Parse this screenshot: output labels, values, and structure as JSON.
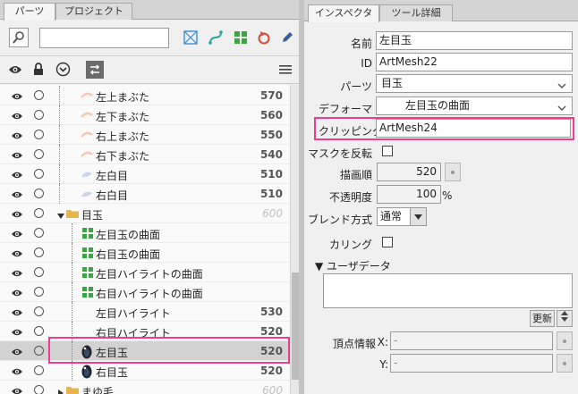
{
  "left_panel": {
    "tabs": [
      {
        "label": "パーツ",
        "active": true
      },
      {
        "label": "プロジェクト",
        "active": false
      }
    ],
    "search": {
      "value": "",
      "placeholder": ""
    },
    "toolbar_icons": [
      "zoom-icon",
      "mesh-edit-icon",
      "curve-icon",
      "deformer-grid-icon",
      "rotation-deformer-icon",
      "pen-icon"
    ],
    "header_icons": [
      "eye-icon",
      "lock-icon",
      "chevron-circle-icon",
      "swap-icon",
      "menu-icon"
    ],
    "rows": [
      {
        "label": "左上まぶた",
        "order": "570",
        "type": "mesh",
        "thumb": "lid",
        "dim": false
      },
      {
        "label": "左下まぶた",
        "order": "560",
        "type": "mesh",
        "thumb": "lid",
        "dim": false
      },
      {
        "label": "右上まぶた",
        "order": "550",
        "type": "mesh",
        "thumb": "lid",
        "dim": false
      },
      {
        "label": "右下まぶた",
        "order": "540",
        "type": "mesh",
        "thumb": "lid",
        "dim": false
      },
      {
        "label": "左白目",
        "order": "510",
        "type": "mesh",
        "thumb": "white",
        "dim": false
      },
      {
        "label": "右白目",
        "order": "510",
        "type": "mesh",
        "thumb": "white",
        "dim": false
      },
      {
        "label": "目玉",
        "order": "600",
        "type": "folder",
        "thumb": "folder",
        "dim": true
      },
      {
        "label": "左目玉の曲面",
        "order": "",
        "type": "deformer",
        "thumb": "deformer",
        "dim": false
      },
      {
        "label": "右目玉の曲面",
        "order": "",
        "type": "deformer",
        "thumb": "deformer",
        "dim": false
      },
      {
        "label": "左目ハイライトの曲面",
        "order": "",
        "type": "deformer",
        "thumb": "deformer",
        "dim": false
      },
      {
        "label": "右目ハイライトの曲面",
        "order": "",
        "type": "deformer",
        "thumb": "deformer",
        "dim": false
      },
      {
        "label": "左目ハイライト",
        "order": "530",
        "type": "mesh",
        "thumb": "none",
        "dim": false
      },
      {
        "label": "右目ハイライト",
        "order": "520",
        "type": "mesh",
        "thumb": "none",
        "dim": false
      },
      {
        "label": "左目玉",
        "order": "520",
        "type": "mesh",
        "thumb": "eyeball",
        "dim": false,
        "selected": true
      },
      {
        "label": "右目玉",
        "order": "520",
        "type": "mesh",
        "thumb": "eyeball",
        "dim": false
      },
      {
        "label": "まゆ毛",
        "order": "600",
        "type": "folder",
        "thumb": "folder",
        "dim": true
      }
    ]
  },
  "right_panel": {
    "tabs": [
      {
        "label": "インスペクタ",
        "active": true
      },
      {
        "label": "ツール詳細",
        "active": false
      }
    ],
    "name_label": "名前",
    "name_value": "左目玉",
    "id_label": "ID",
    "id_value": "ArtMesh22",
    "parts_label": "パーツ",
    "parts_value": "目玉",
    "deformer_label": "デフォーマ",
    "deformer_value": "左目玉の曲面",
    "clipping_label": "クリッピング",
    "clipping_value": "ArtMesh24",
    "mask_invert_label": "マスクを反転",
    "draw_order_label": "描画順",
    "draw_order_value": "520",
    "opacity_label": "不透明度",
    "opacity_value": "100",
    "opacity_unit": "%",
    "blend_label": "ブレンド方式",
    "blend_value": "通常",
    "culling_label": "カリング",
    "userdata_label": "▼ ユーザデータ",
    "update_button": "更新",
    "vertex_label": "頂点情報",
    "x_label": "X:",
    "x_value": "-",
    "y_label": "Y:",
    "y_value": "-"
  },
  "colors": {
    "highlight": "#ee3d8c",
    "deformer_green": "#3aa640",
    "folder_yellow": "#e8b54a"
  }
}
